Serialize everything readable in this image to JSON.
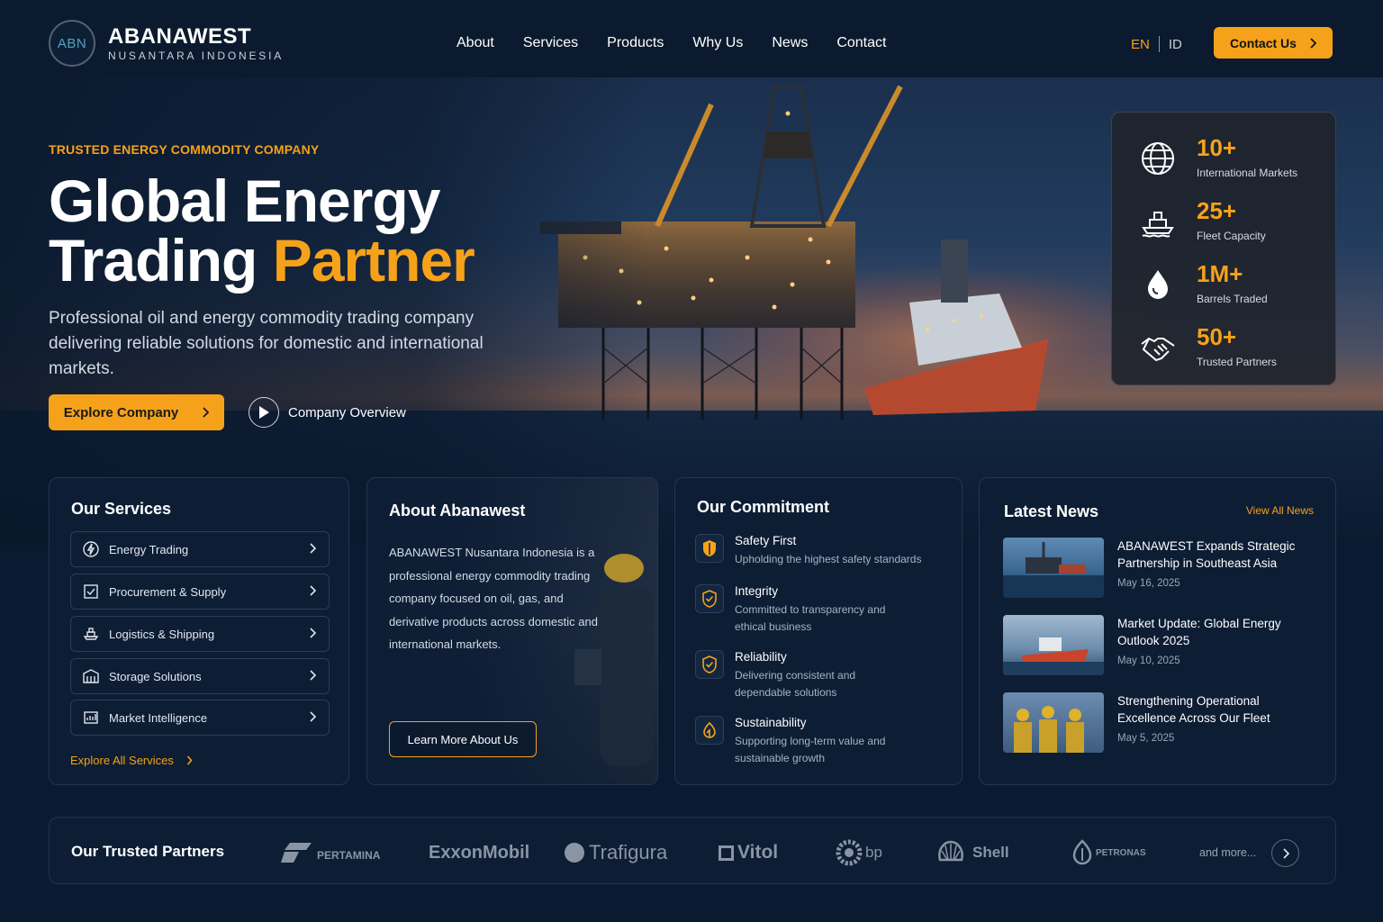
{
  "brand": {
    "logo_mark": "ABN",
    "name": "ABANAWEST",
    "subtitle": "NUSANTARA INDONESIA"
  },
  "nav": [
    {
      "label": "About"
    },
    {
      "label": "Services"
    },
    {
      "label": "Products"
    },
    {
      "label": "Why Us"
    },
    {
      "label": "News"
    },
    {
      "label": "Contact"
    }
  ],
  "lang": {
    "active": "EN",
    "other": "ID"
  },
  "header": {
    "contact_label": "Contact Us"
  },
  "hero": {
    "eyebrow": "TRUSTED ENERGY COMMODITY COMPANY",
    "title_line1": "Global Energy",
    "title_line2_a": "Trading ",
    "title_line2_b": "Partner",
    "description": "Professional oil and energy commodity trading company delivering reliable solutions for domestic and international markets.",
    "primary_cta": "Explore Company",
    "secondary_cta": "Company Overview"
  },
  "stats": [
    {
      "value": "10+",
      "label": "International Markets",
      "icon": "globe-icon"
    },
    {
      "value": "25+",
      "label": "Fleet Capacity",
      "icon": "ship-icon"
    },
    {
      "value": "1M+",
      "label": "Barrels Traded",
      "icon": "oil-drop-icon"
    },
    {
      "value": "50+",
      "label": "Trusted Partners",
      "icon": "handshake-icon"
    }
  ],
  "services": {
    "title": "Our Services",
    "items": [
      {
        "label": "Energy Trading",
        "icon": "energy-icon"
      },
      {
        "label": "Procurement & Supply",
        "icon": "clipboard-icon"
      },
      {
        "label": "Logistics & Shipping",
        "icon": "ship-icon"
      },
      {
        "label": "Storage Solutions",
        "icon": "warehouse-icon"
      },
      {
        "label": "Market Intelligence",
        "icon": "chart-icon"
      }
    ],
    "link": "Explore All Services"
  },
  "about": {
    "title": "About Abanawest",
    "text": "ABANAWEST Nusantara Indonesia is a professional energy commodity trading company focused on oil, gas, and derivative products across domestic and international markets.",
    "cta": "Learn More About Us"
  },
  "commitment": {
    "title": "Our Commitment",
    "items": [
      {
        "title": "Safety First",
        "desc": "Upholding the highest safety standards",
        "icon": "shield-icon"
      },
      {
        "title": "Integrity",
        "desc": "Committed to transparency and ethical business",
        "icon": "shield-check-icon"
      },
      {
        "title": "Reliability",
        "desc": "Delivering consistent and dependable solutions",
        "icon": "shield-check-icon"
      },
      {
        "title": "Sustainability",
        "desc": "Supporting long-term value and sustainable growth",
        "icon": "leaf-icon"
      }
    ]
  },
  "news": {
    "title": "Latest News",
    "view_all": "View All News",
    "items": [
      {
        "title": "ABANAWEST Expands Strategic Partnership in Southeast Asia",
        "date": "May 16, 2025"
      },
      {
        "title": "Market Update: Global Energy Outlook 2025",
        "date": "May 10, 2025"
      },
      {
        "title": "Strengthening Operational Excellence Across Our Fleet",
        "date": "May 5, 2025"
      }
    ]
  },
  "partners": {
    "title": "Our Trusted Partners",
    "logos": [
      "PERTAMINA",
      "ExxonMobil",
      "Trafigura",
      "Vitol",
      "bp",
      "Shell",
      "PETRONAS"
    ],
    "more": "and more..."
  },
  "colors": {
    "accent": "#f5a21a",
    "background": "#0a1a30",
    "card": "#0d1d34"
  }
}
